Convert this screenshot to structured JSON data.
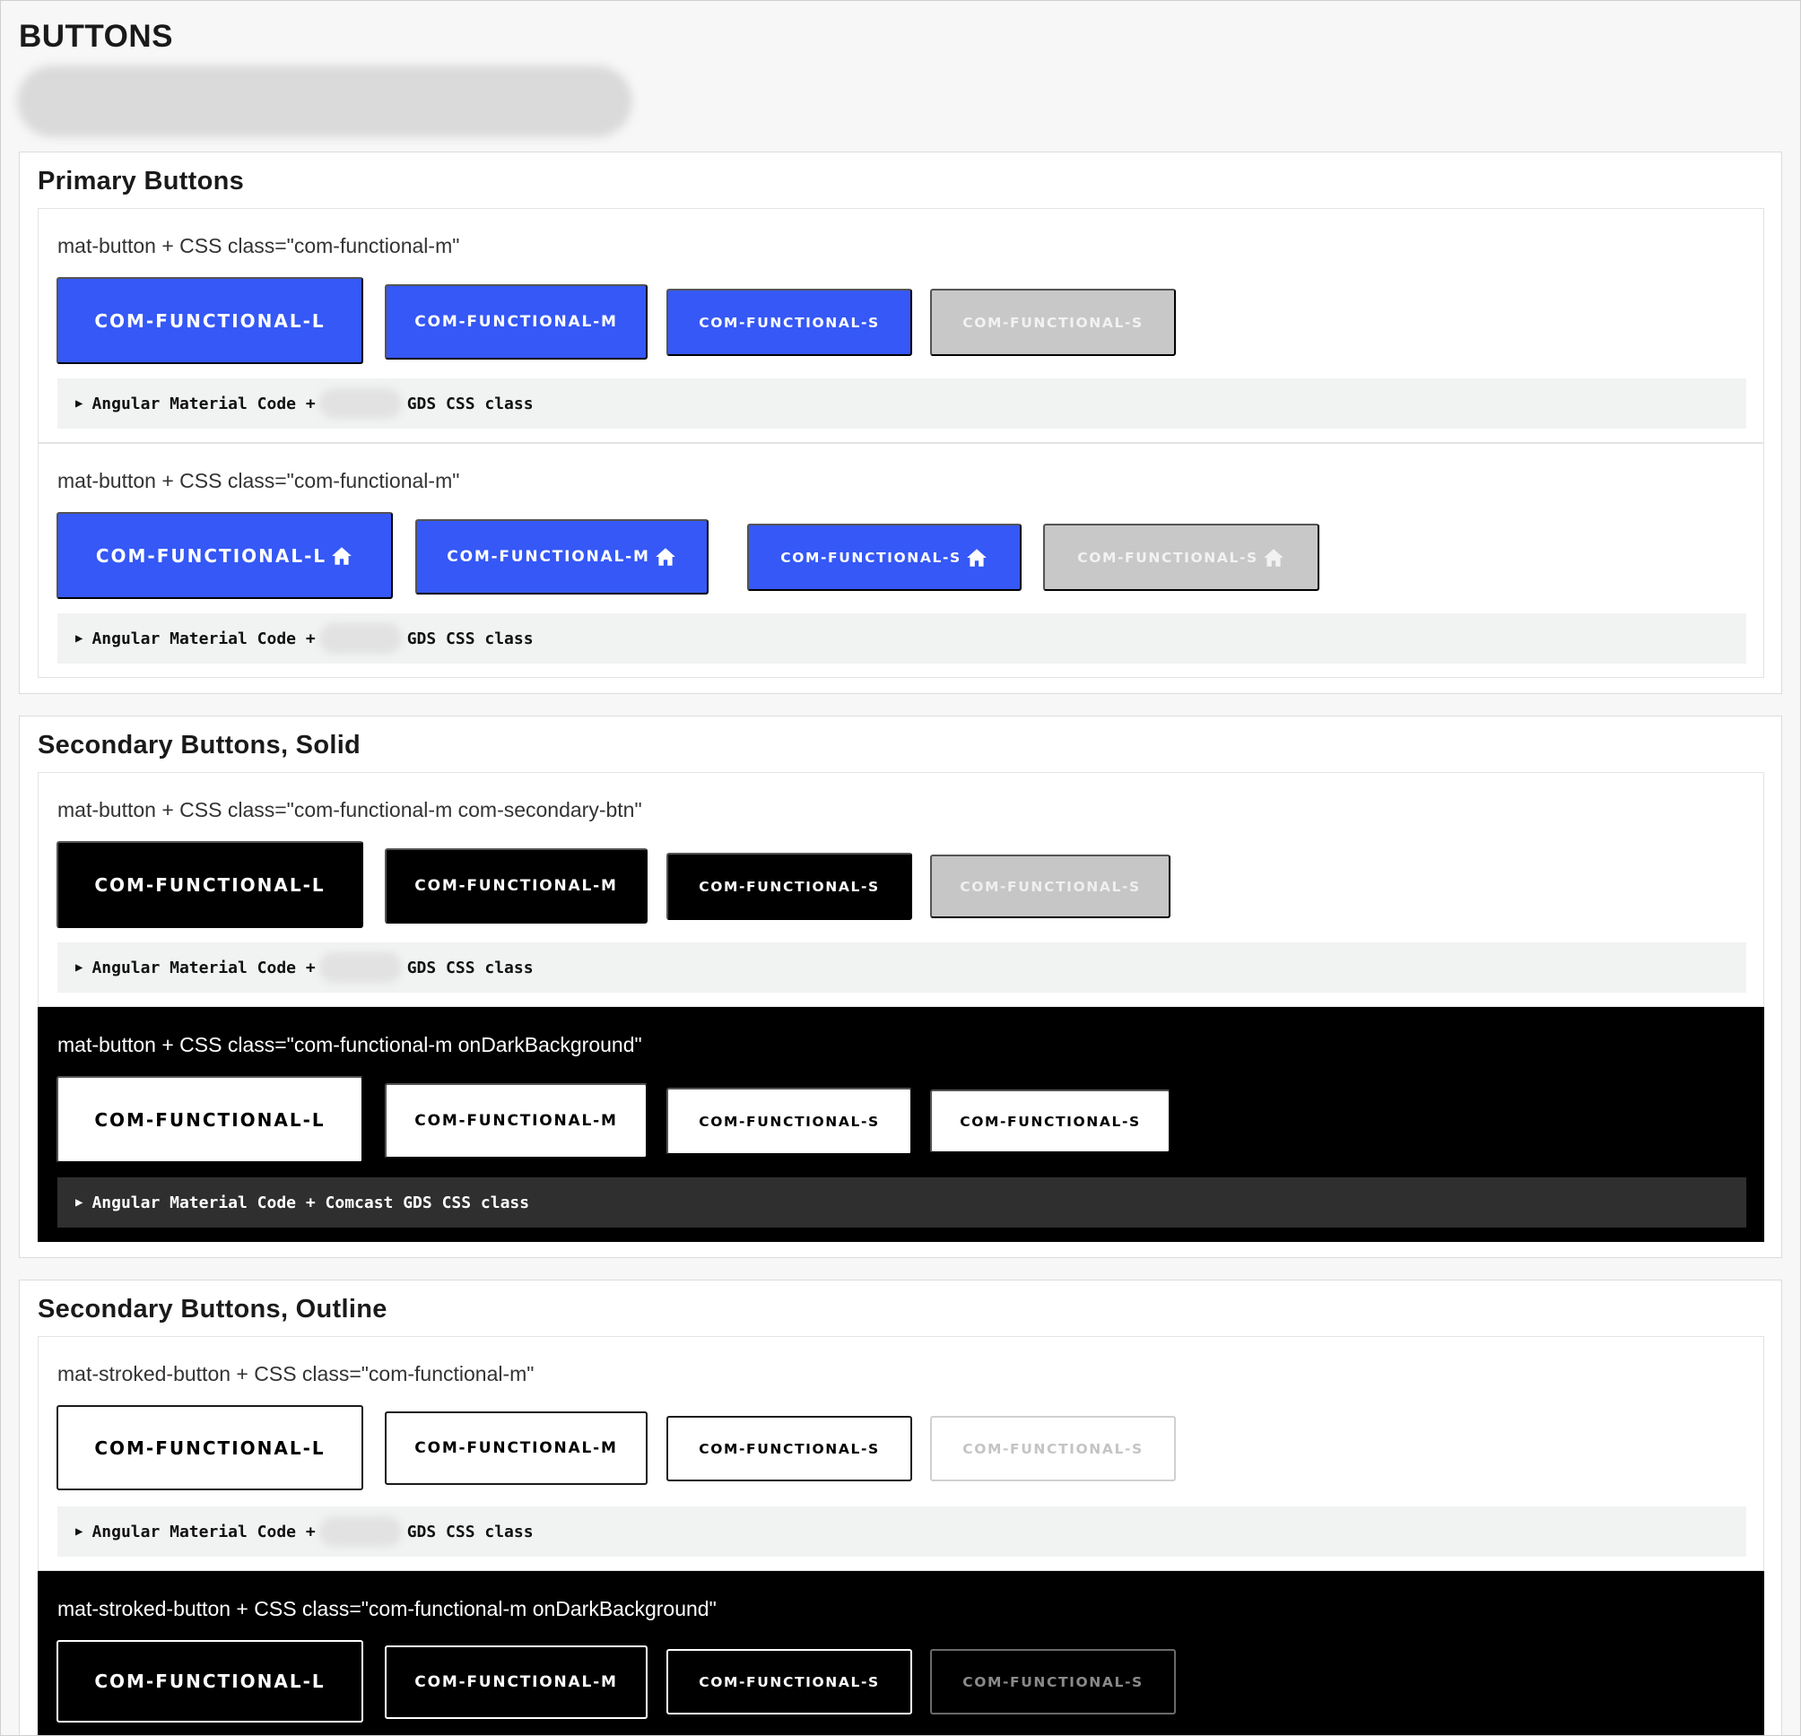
{
  "page_title": "BUTTONS",
  "code_summary": {
    "prefix": "Angular Material Code +",
    "suffix": "GDS CSS class",
    "full_dark": "Angular Material Code + Comcast GDS CSS class"
  },
  "sections": {
    "primary": {
      "title": "Primary Buttons",
      "demo1": {
        "label": "mat-button + CSS class=\"com-functional-m\"",
        "buttons": [
          "COM-FUNCTIONAL-L",
          "COM-FUNCTIONAL-M",
          "COM-FUNCTIONAL-S",
          "COM-FUNCTIONAL-S"
        ]
      },
      "demo2": {
        "label": "mat-button + CSS class=\"com-functional-m\"",
        "buttons": [
          "COM-FUNCTIONAL-L",
          "COM-FUNCTIONAL-M",
          "COM-FUNCTIONAL-S",
          "COM-FUNCTIONAL-S"
        ],
        "icon": "home-icon"
      }
    },
    "secondary_solid": {
      "title": "Secondary Buttons, Solid",
      "demo1": {
        "label": "mat-button + CSS class=\"com-functional-m com-secondary-btn\"",
        "buttons": [
          "COM-FUNCTIONAL-L",
          "COM-FUNCTIONAL-M",
          "COM-FUNCTIONAL-S",
          "COM-FUNCTIONAL-S"
        ]
      },
      "demo2": {
        "label": "mat-button + CSS class=\"com-functional-m onDarkBackground\"",
        "buttons": [
          "COM-FUNCTIONAL-L",
          "COM-FUNCTIONAL-M",
          "COM-FUNCTIONAL-S",
          "COM-FUNCTIONAL-S"
        ]
      }
    },
    "secondary_outline": {
      "title": "Secondary Buttons, Outline",
      "demo1": {
        "label": "mat-stroked-button + CSS class=\"com-functional-m\"",
        "buttons": [
          "COM-FUNCTIONAL-L",
          "COM-FUNCTIONAL-M",
          "COM-FUNCTIONAL-S",
          "COM-FUNCTIONAL-S"
        ]
      },
      "demo2": {
        "label": "mat-stroked-button + CSS class=\"com-functional-m onDarkBackground\"",
        "buttons": [
          "COM-FUNCTIONAL-L",
          "COM-FUNCTIONAL-M",
          "COM-FUNCTIONAL-S",
          "COM-FUNCTIONAL-S"
        ]
      }
    }
  },
  "colors": {
    "primary": "#3558f6",
    "disabled": "#c8c8c8",
    "secondary": "#000000",
    "code_bg": "#f1f2f2",
    "code_bg_dark": "#2f2f2f"
  }
}
